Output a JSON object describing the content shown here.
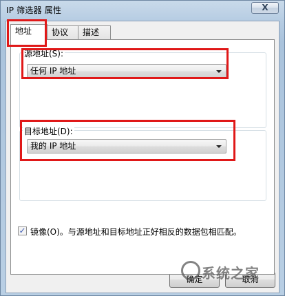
{
  "window": {
    "title": "IP 筛选器 属性",
    "close_glyph": "X"
  },
  "tabs": [
    {
      "label": "地址"
    },
    {
      "label": "协议"
    },
    {
      "label": "描述"
    }
  ],
  "source": {
    "label": "源地址(S):",
    "selected": "任何 IP 地址"
  },
  "destination": {
    "label": "目标地址(D):",
    "selected": "我的 IP 地址"
  },
  "mirror": {
    "checked": true,
    "check_glyph": "✓",
    "label": "镜像(O)。与源地址和目标地址正好相反的数据包相匹配。"
  },
  "buttons": {
    "ok": "确定",
    "cancel": "取消"
  },
  "watermark": "系统之家",
  "highlight_color": "#e01818"
}
